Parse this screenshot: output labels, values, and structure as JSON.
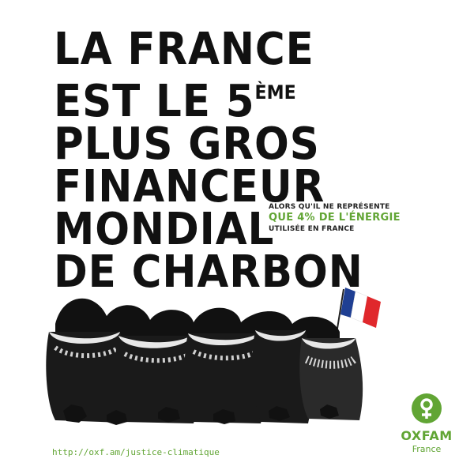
{
  "headline": {
    "line1": "LA FRANCE",
    "line2": "EST LE 5",
    "line2_sup": "ÈME",
    "line3": "PLUS GROS",
    "line4": "FINANCEUR",
    "line5": "MONDIAL",
    "line6": "DE CHARBON"
  },
  "subtext": {
    "line1": "ALORS QU'IL NE REPRÉSENTE",
    "line2": "QUE 4% DE L'ÉNERGIE",
    "line3": "UTILISÉE EN FRANCE"
  },
  "url": "http://oxf.am/justice-climatique",
  "logo": {
    "brand": "OXFAM",
    "country": "France"
  },
  "colors": {
    "accent_green": "#61a534",
    "ink": "#111111",
    "flag_blue": "#1f3f93",
    "flag_red": "#e0282c"
  },
  "illustration": {
    "description_icon": "coal-sacks-with-french-flag"
  }
}
